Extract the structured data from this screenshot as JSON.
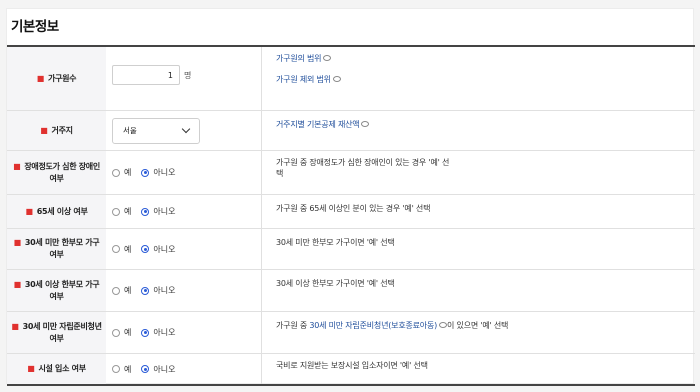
{
  "section_title": "기본정보",
  "required_mark": "■",
  "household_size": {
    "label": "가구원수",
    "value": "1",
    "unit": "명",
    "help_links": [
      "가구원의 범위",
      "가구원 제외 범위"
    ]
  },
  "residence": {
    "label": "거주지",
    "selected": "서울",
    "help_links": [
      "거주지별 기본공제 재산액"
    ]
  },
  "radio_options": {
    "yes": "예",
    "no": "아니오"
  },
  "questions": [
    {
      "label": "장애정도가 심한 장애인 여부",
      "selected": "no",
      "desc": "가구원 중 장애정도가 심한 장애인이 있는 경우 '예' 선택"
    },
    {
      "label": "65세 이상 여부",
      "selected": "no",
      "desc": "가구원 중 65세 이상인 분이 있는 경우 '예' 선택"
    },
    {
      "label": "30세 미만 한부모 가구 여부",
      "selected": "no",
      "desc": "30세 미만 한부모 가구이면 '예' 선택"
    },
    {
      "label": "30세 이상 한부모 가구 여부",
      "selected": "no",
      "desc": "30세 이상 한부모 가구이면 '예' 선택"
    },
    {
      "label": "30세 미만 자립준비청년 여부",
      "selected": "no",
      "desc_before": "가구원 중 ",
      "desc_link": "30세 미만 자립준비청년(보호종료아동)",
      "desc_after": "이 있으면 '예' 선택"
    },
    {
      "label": "시설 입소 여부",
      "selected": "no",
      "desc": "국비로 지원받는 보장시설 입소자이면 '예' 선택"
    }
  ],
  "colors": {
    "required": "#e0312f",
    "link": "#1d4c9a",
    "radio_on": "#2a5bd7",
    "header_bg": "#f5f5f7"
  }
}
